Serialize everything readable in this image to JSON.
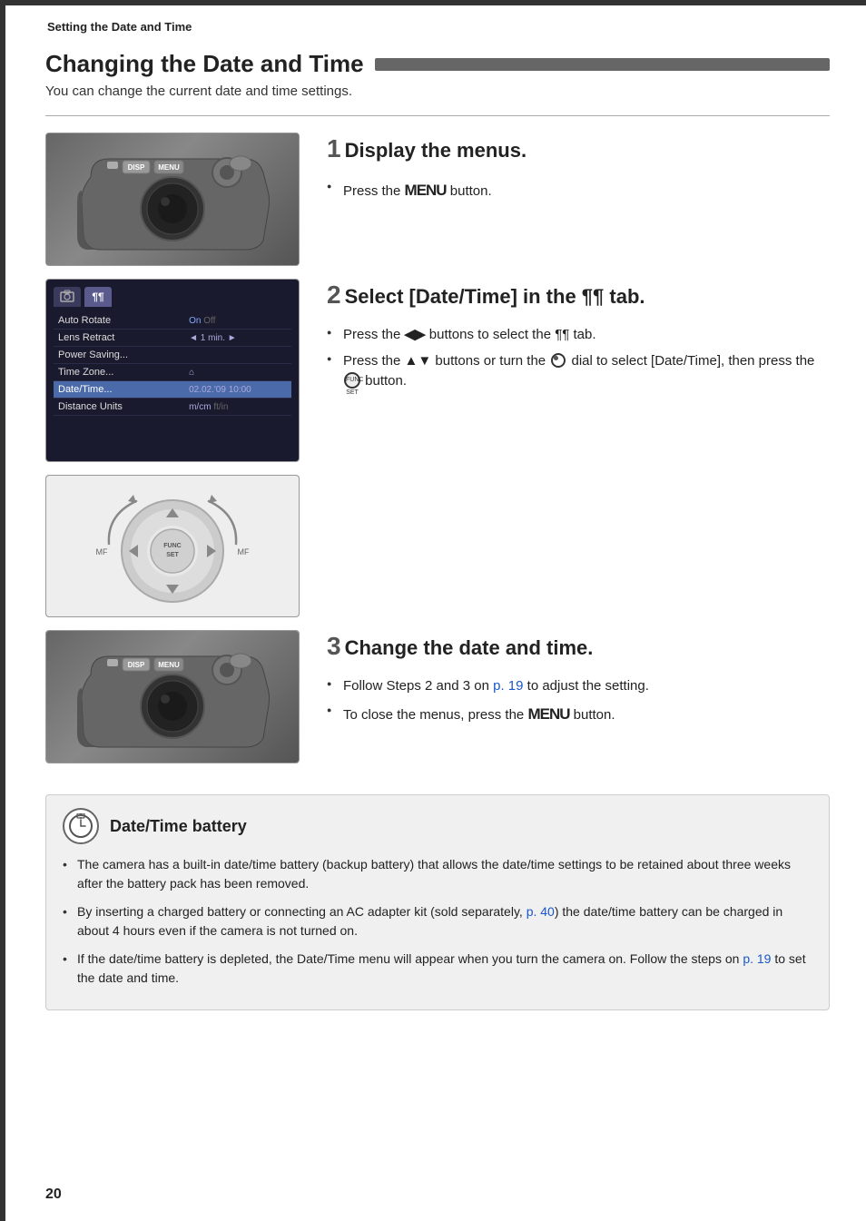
{
  "breadcrumb": "Setting the Date and Time",
  "title": "Changing the Date and Time",
  "subtitle": "You can change the current date and time settings.",
  "steps": [
    {
      "number": "1",
      "title": "Display the menus.",
      "bullets": [
        {
          "text": "Press the ",
          "bold": "MENU",
          "rest": " button."
        }
      ]
    },
    {
      "number": "2",
      "title": "Select [Date/Time] in the ¶¶ tab.",
      "bullets": [
        {
          "text": "Press the ◀▶ buttons to select the ¶¶ tab."
        },
        {
          "text": "Press the ▲▼ buttons or turn the  dial to select [Date/Time], then press the  button."
        }
      ]
    },
    {
      "number": "3",
      "title": "Change the date and time.",
      "bullets": [
        {
          "text": "Follow Steps 2 and 3 on p. 19 to adjust the setting.",
          "link": "p. 19"
        },
        {
          "text": "To close the menus, press the MENU button."
        }
      ]
    }
  ],
  "menu_screen": {
    "tabs": [
      "▣",
      "¶¶"
    ],
    "rows": [
      {
        "label": "Auto Rotate",
        "value": "On  Off"
      },
      {
        "label": "Lens Retract",
        "value": "◄ 1 min.  ►"
      },
      {
        "label": "Power Saving...",
        "value": ""
      },
      {
        "label": "Time Zone...",
        "value": "⌂"
      },
      {
        "label": "Date/Time...",
        "value": "02.02.'09 10:00",
        "highlight": true
      },
      {
        "label": "Distance Units",
        "value": "m/cm  ft/in"
      }
    ]
  },
  "note": {
    "title": "Date/Time battery",
    "bullets": [
      "The camera has a built-in date/time battery (backup battery) that allows the date/time settings to be retained about three weeks after the battery pack has been removed.",
      "By inserting a charged battery or connecting an AC adapter kit (sold separately, p. 40) the date/time battery can be charged in about 4 hours even if the camera is not turned on.",
      "If the date/time battery is depleted, the Date/Time menu will appear when you turn the camera on. Follow the steps on p. 19 to set the date and time."
    ],
    "links": [
      "p. 40",
      "p. 19"
    ]
  },
  "page_number": "20",
  "labels": {
    "disp": "DISP",
    "menu": "MENU",
    "func_set": "FUNC\nSET",
    "mf": "MF"
  }
}
